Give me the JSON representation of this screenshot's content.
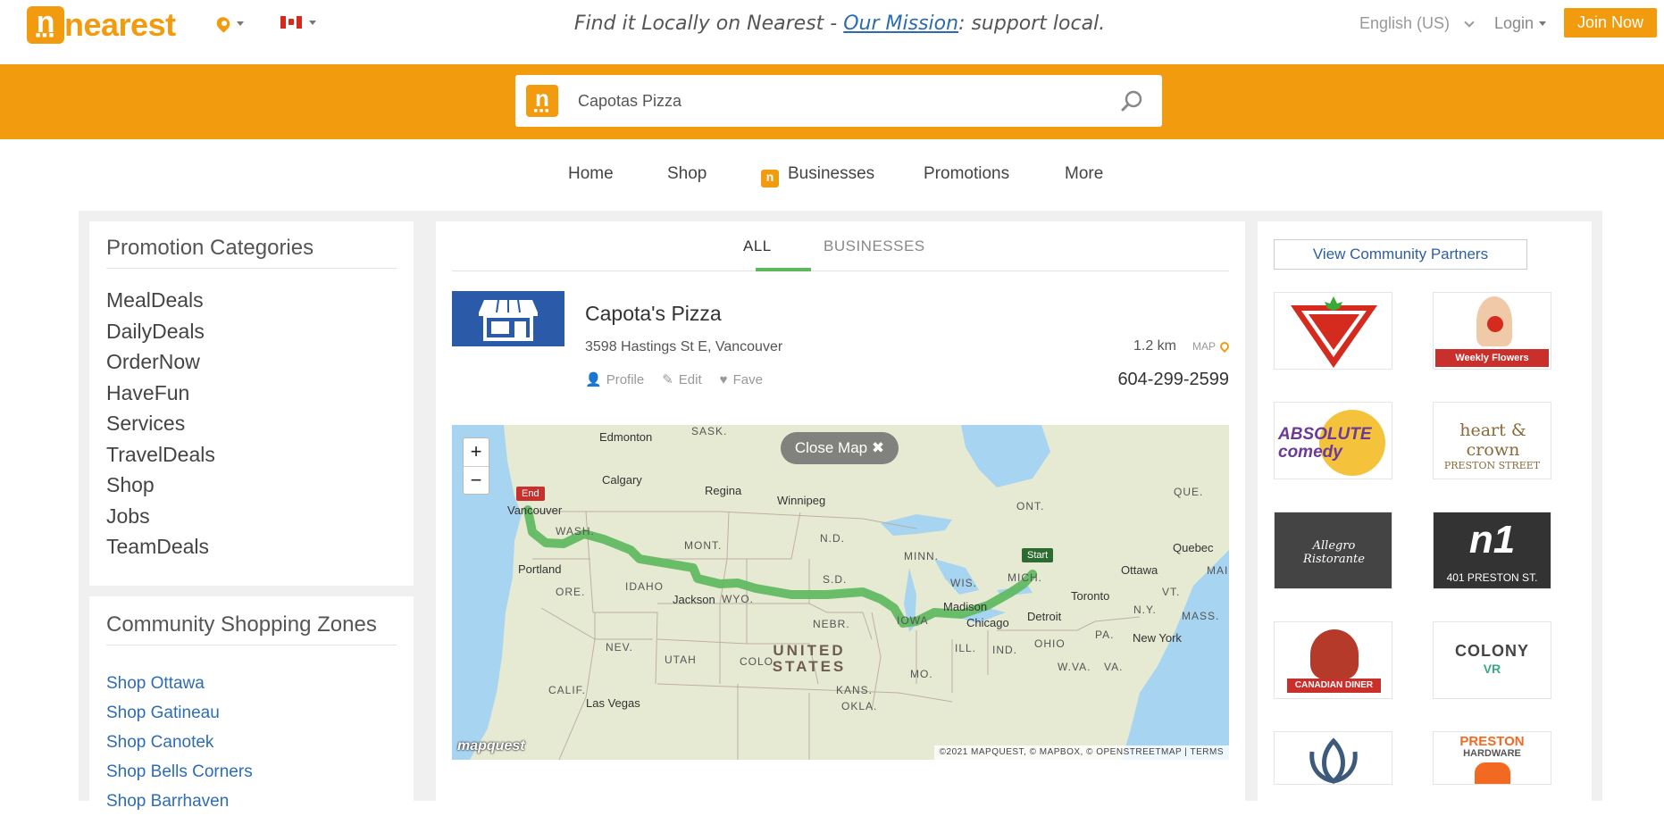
{
  "header": {
    "brand": "nearest",
    "tagline_pre": "Find it Locally on Nearest - ",
    "tagline_link": "Our Mission",
    "tagline_post": ": support local.",
    "language": "English (US)",
    "login": "Login",
    "join": "Join Now"
  },
  "search": {
    "value": "Capotas Pizza"
  },
  "nav": {
    "home": "Home",
    "shop": "Shop",
    "businesses": "Businesses",
    "promotions": "Promotions",
    "more": "More"
  },
  "left": {
    "promo_title": "Promotion Categories",
    "categories": [
      "MealDeals",
      "DailyDeals",
      "OrderNow",
      "HaveFun",
      "Services",
      "TravelDeals",
      "Shop",
      "Jobs",
      "TeamDeals"
    ],
    "zones_title": "Community Shopping Zones",
    "zones": [
      "Shop Ottawa",
      "Shop Gatineau",
      "Shop Canotek",
      "Shop Bells Corners",
      "Shop Barrhaven"
    ]
  },
  "center": {
    "tab_all": "ALL",
    "tab_businesses": "BUSINESSES",
    "business": {
      "name": "Capota's Pizza",
      "address": "3598 Hastings St E, Vancouver",
      "profile": "Profile",
      "edit": "Edit",
      "fave": "Fave",
      "distance": "1.2 km",
      "map_tag": "MAP",
      "phone": "604-299-2599"
    },
    "map": {
      "close": "Close Map",
      "zoom_in": "+",
      "zoom_out": "−",
      "start": "Start",
      "end": "End",
      "provider": "mapquest",
      "attribution": "©2021 MAPQUEST, © MAPBOX, © OPENSTREETMAP | TERMS",
      "labels": [
        "Edmonton",
        "SASK.",
        "Calgary",
        "Regina",
        "Winnipeg",
        "Vancouver",
        "WASH.",
        "Portland",
        "ORE.",
        "IDAHO",
        "MONT.",
        "N.D.",
        "MINN.",
        "S.D.",
        "WYO.",
        "Jackson",
        "NEBR.",
        "IOWA",
        "WIS.",
        "Madison",
        "Chicago",
        "MICH.",
        "Detroit",
        "Toronto",
        "Ottawa",
        "Quebec",
        "QUE.",
        "ONT.",
        "VT.",
        "N.Y.",
        "MASS.",
        "New York",
        "PA.",
        "OHIO",
        "IND.",
        "ILL.",
        "MO.",
        "W.VA.",
        "VA.",
        "NEV.",
        "UTAH",
        "COLO.",
        "KANS.",
        "CALIF.",
        "Las Vegas",
        "OKLA.",
        "MAIN"
      ],
      "country": "UNITED STATES"
    }
  },
  "right": {
    "partners_button": "View Community Partners",
    "logos": [
      {
        "name": "canadian-tire",
        "text": "CANADIAN TIRE"
      },
      {
        "name": "weekly-flowers",
        "text": "Weekly Flowers"
      },
      {
        "name": "absolute-comedy",
        "text": "ABSOLUTE comedy"
      },
      {
        "name": "heart-and-crown",
        "text": "heart & crown",
        "sub": "PRESTON STREET"
      },
      {
        "name": "allegro",
        "text": "Allegro Ristorante"
      },
      {
        "name": "n1",
        "text": "n1",
        "sub": "401 PRESTON ST."
      },
      {
        "name": "canadian-diner",
        "text": "CANADIAN DINER"
      },
      {
        "name": "colony-vr",
        "text": "COLONY",
        "sub": "VR"
      },
      {
        "name": "lotus",
        "text": ""
      },
      {
        "name": "preston-hardware",
        "text": "PRESTON",
        "sub": "HARDWARE"
      }
    ]
  },
  "colors": {
    "brand_orange": "#f29b0f",
    "link_blue": "#2e6db4",
    "route_green": "#5cb85c"
  }
}
